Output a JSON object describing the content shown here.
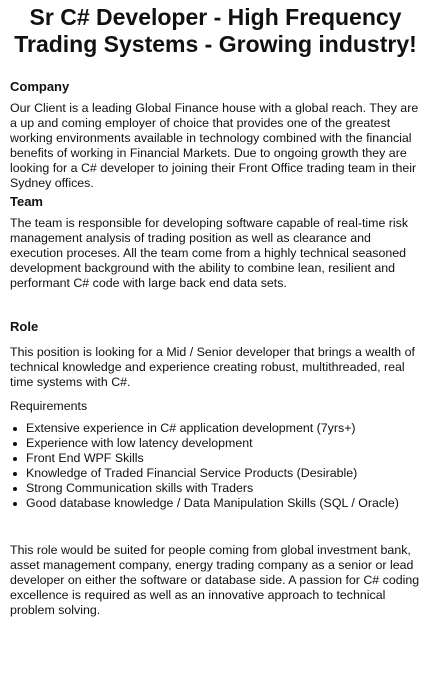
{
  "title": "Sr C# Developer - High Frequency Trading Systems - Growing industry!",
  "company": {
    "heading": "Company",
    "body": "Our Client is a leading Global Finance house with a global reach. They are a up and coming employer of choice that provides one of the greatest working environments available in technology combined with the financial benefits of working in Financial Markets. Due to ongoing growth they are looking for a C# developer to joining their Front Office trading team in their Sydney offices."
  },
  "team": {
    "heading": "Team",
    "body": "The team is responsible for developing software capable of real-time risk management analysis of trading position as well as clearance and execution proceses. All the team come from a highly technical seasoned development background with the ability to combine lean, resilient and performant C# code with large back end data sets."
  },
  "role": {
    "heading": "Role",
    "body": "This position is looking for a Mid / Senior developer that brings a wealth of technical knowledge and experience creating robust, multithreaded, real time systems with C#.",
    "requirements_label": "Requirements",
    "requirements": [
      "Extensive experience in C# application development (7yrs+)",
      "Experience with low latency development",
      "Front End WPF Skills",
      "Knowledge of Traded Financial Service Products (Desirable)",
      "Strong Communication skills with Traders",
      "Good database knowledge / Data Manipulation Skills (SQL / Oracle)"
    ]
  },
  "closing": "This role would be suited for people coming from global investment bank, asset management company, energy trading company as a senior or lead developer on either the software or database side. A passion for C# coding excellence is required as well as an innovative approach to technical problem solving."
}
